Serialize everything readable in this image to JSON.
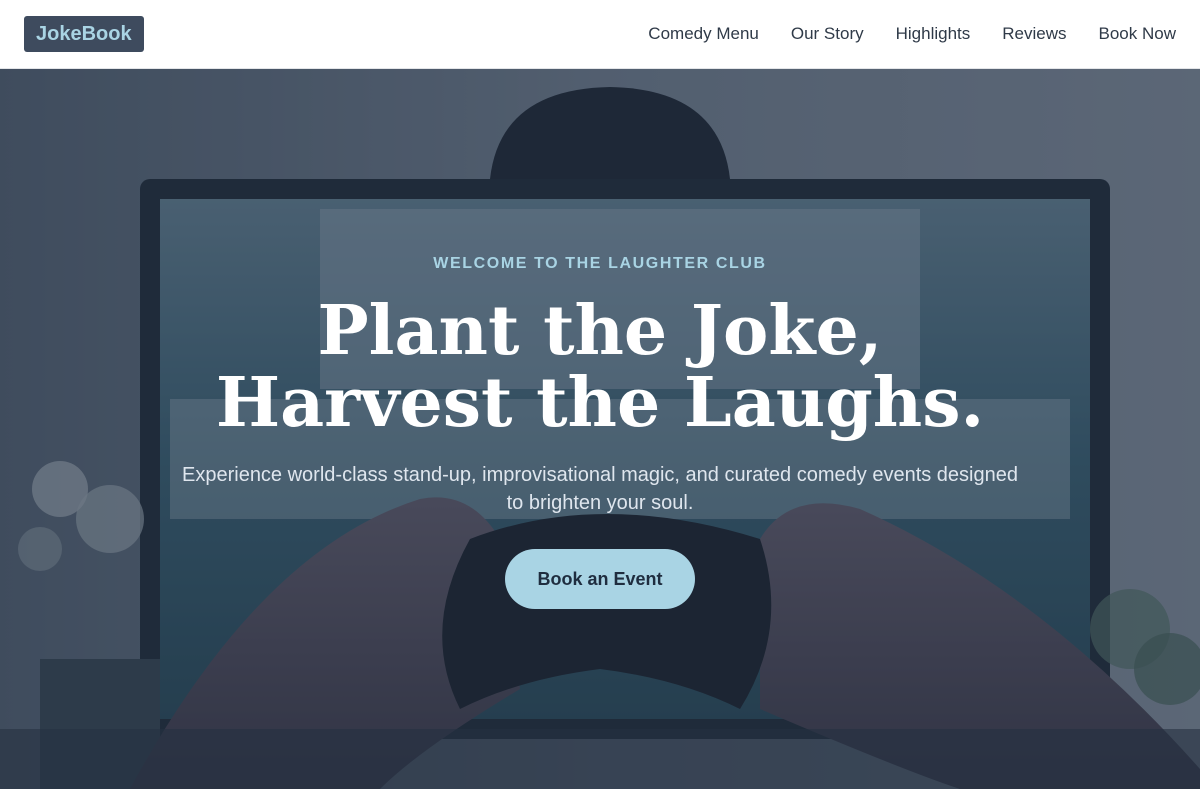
{
  "nav": {
    "logo": "JokeBook",
    "links": [
      "Comedy Menu",
      "Our Story",
      "Highlights",
      "Reviews",
      "Book Now"
    ]
  },
  "hero": {
    "eyebrow": "WELCOME TO THE LAUGHTER CLUB",
    "headline": "Plant the Joke, Harvest the Laughs.",
    "subhead": "Experience world-class stand-up, improvisational magic, and curated comedy events designed to brighten your soul.",
    "cta": "Book an Event"
  },
  "colors": {
    "accent": "#a9d4e4",
    "logo_bg": "#3e4b5e",
    "nav_text": "#2f3a48",
    "overlay": "#1e2c40"
  }
}
